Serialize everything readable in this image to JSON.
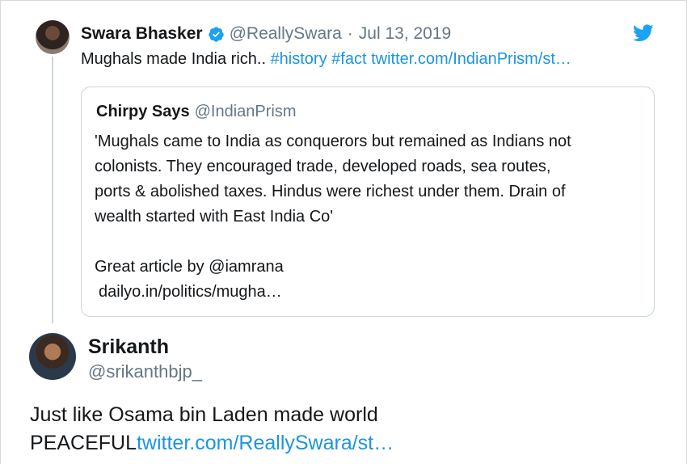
{
  "tweet": {
    "author_name": "Swara Bhasker",
    "handle": "@ReallySwara",
    "separator": "·",
    "date": "Jul 13, 2019",
    "text_plain": "Mughals made India rich.. ",
    "hashtag_history": "#history",
    "hashtag_fact": "#fact",
    "link": "twitter.com/IndianPrism/st…",
    "icons": {
      "verified": "verified-badge-icon",
      "logo": "twitter-bird-icon"
    },
    "colors": {
      "link": "#1b95e0",
      "muted": "#657786",
      "verified": "#1da1f2"
    }
  },
  "quote": {
    "author_name": "Chirpy Says",
    "handle": "@IndianPrism",
    "lines": [
      "'Mughals came to India as conquerors but remained as Indians not",
      "colonists. They encouraged trade, developed roads, sea routes,",
      "ports & abolished taxes. Hindus were richest under them. Drain of",
      "wealth started with East India Co'"
    ],
    "credit": "Great article by @iamrana",
    "url": "dailyo.in/politics/mugha…"
  },
  "reply": {
    "author_name": "Srikanth",
    "handle": "@srikanthbjp_",
    "line1": "Just like Osama bin Laden made world",
    "line2_plain": "PEACEFUL",
    "line2_link": "twitter.com/ReallySwara/st…"
  }
}
